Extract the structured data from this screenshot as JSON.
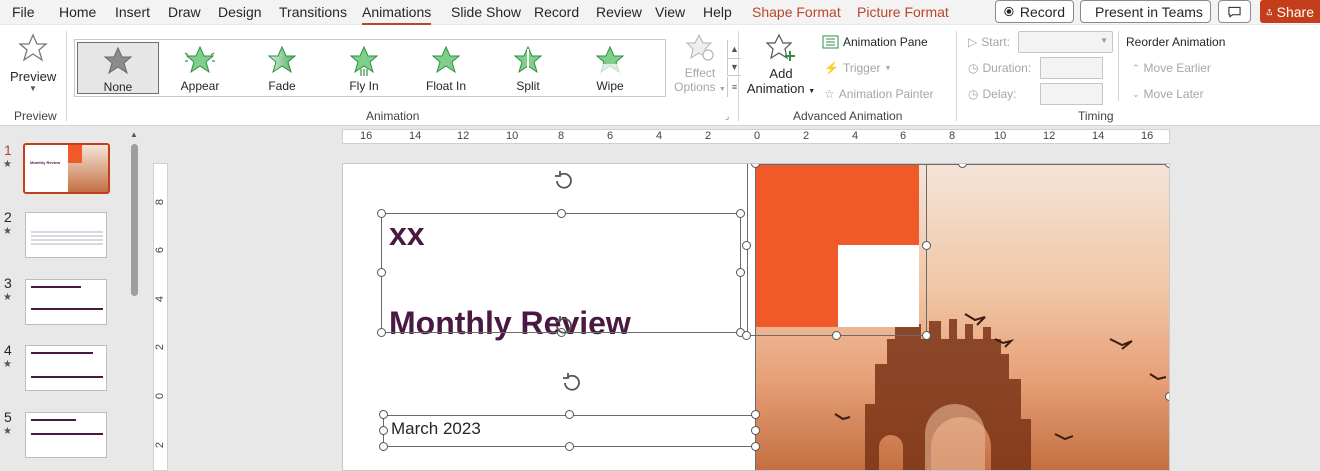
{
  "menu": {
    "tabs": [
      "File",
      "Home",
      "Insert",
      "Draw",
      "Design",
      "Transitions",
      "Animations",
      "Slide Show",
      "Record",
      "Review",
      "View",
      "Help"
    ],
    "active_tab": "Animations",
    "context_tabs": [
      "Shape Format",
      "Picture Format"
    ],
    "record_label": "Record",
    "present_label": "Present in Teams",
    "share_label": "Share"
  },
  "ribbon": {
    "preview": {
      "label": "Preview",
      "group": "Preview"
    },
    "animation_group": "Animation",
    "animations": [
      "None",
      "Appear",
      "Fade",
      "Fly In",
      "Float In",
      "Split",
      "Wipe"
    ],
    "effect_options": [
      "Effect",
      "Options"
    ],
    "advanced": {
      "group": "Advanced Animation",
      "add_animation": [
        "Add",
        "Animation"
      ],
      "animation_pane": "Animation Pane",
      "trigger": "Trigger",
      "animation_painter": "Animation Painter"
    },
    "timing": {
      "group": "Timing",
      "start": "Start:",
      "duration": "Duration:",
      "delay": "Delay:",
      "reorder": "Reorder Animation",
      "move_earlier": "Move Earlier",
      "move_later": "Move Later"
    }
  },
  "thumbnails": {
    "numbers": [
      "1",
      "2",
      "3",
      "4",
      "5"
    ],
    "active": "1",
    "thumb1_title": "Monthly Review"
  },
  "ruler": {
    "h": [
      "16",
      "14",
      "12",
      "10",
      "8",
      "6",
      "4",
      "2",
      "0",
      "2",
      "4",
      "6",
      "8",
      "10",
      "12",
      "14",
      "16"
    ],
    "v": [
      "8",
      "6",
      "4",
      "2",
      "0",
      "2"
    ]
  },
  "slide": {
    "title_xx": "xx",
    "title": "Monthly Review",
    "subtitle": "March 2023"
  },
  "colors": {
    "accent": "#b7472a",
    "orange": "#f05a28",
    "title_purple": "#4a1942",
    "share_bg": "#c43e1c"
  }
}
